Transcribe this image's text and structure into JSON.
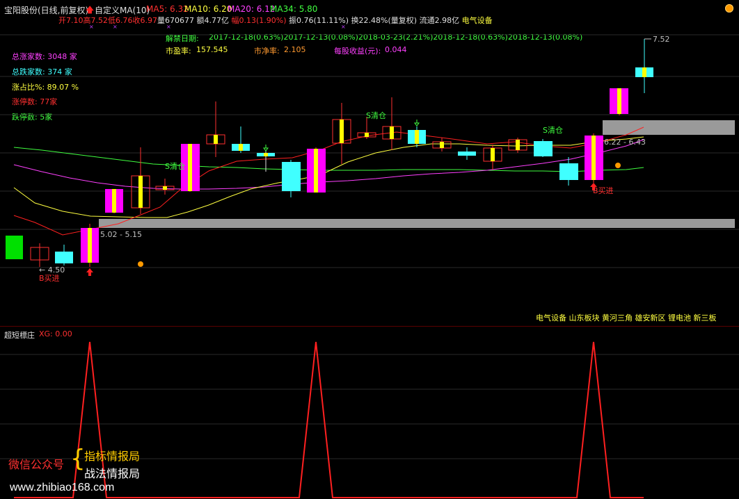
{
  "header": {
    "title": "宝阳股份(日线,前复权)",
    "custom_label": "自定义MA(10)",
    "ma5": "MA5: 6.32",
    "ma10": "MA10: 6.20",
    "ma20": "MA20: 6.12",
    "ma34": "MA34: 5.80",
    "row2": {
      "open": "开7.10",
      "high": "高7.52",
      "low": "低6.76",
      "close": "收6.97",
      "volume": "量670677",
      "amount": "额4.77亿",
      "change": "幅0.13(1.90%)",
      "amplitude": "振0.76(11.11%)",
      "turnover": "换22.48%(量复权)",
      "float": "流通2.98亿",
      "industry": "电气设备"
    },
    "colors": {
      "ma5": "#ff3030",
      "ma10": "#ffff40",
      "ma20": "#ff40ff",
      "ma34": "#40ff40"
    }
  },
  "info": {
    "unlock_label": "解禁日期:",
    "unlock_dates": "2017-12-18(0.63%)2017-12-13(0.08%)2018-03-23(2.21%)2018-12-18(0.63%)2018-12-13(0.08%)",
    "pe_label": "市盈率:",
    "pe_value": "157.545",
    "pb_label": "市净率:",
    "pb_value": "2.105",
    "eps_label": "每股收益(元):",
    "eps_value": "0.044"
  },
  "market_stats": {
    "up_label": "总涨家数:",
    "up_value": "3048 家",
    "down_label": "总跌家数:",
    "down_value": "374 家",
    "ratio_label": "涨占比%:",
    "ratio_value": "89.07 %",
    "limit_up_label": "涨停数:",
    "limit_up_value": "77家",
    "limit_down_label": "跌停数:",
    "limit_down_value": "5家"
  },
  "annotations": {
    "high_price": "7.52",
    "zone_upper": "6.22 - 6.43",
    "zone_lower": "5.02 - 5.15",
    "low_price": "4.50",
    "buy_signal": "B买进",
    "sell_signal": "S清仓"
  },
  "concepts": "电气设备 山东板块 黄河三角 雄安新区 锂电池 新三板",
  "indicator": {
    "name": "超短標庄",
    "xg": "XG: 0.00",
    "line_color": "#ff2020",
    "peaks_at_candles": [
      3,
      12,
      23
    ]
  },
  "watermark": {
    "left": "微信公众号",
    "line1": "指标情报局",
    "line2": "战法情报局",
    "url": "www.zhibiao168.com"
  }
}
